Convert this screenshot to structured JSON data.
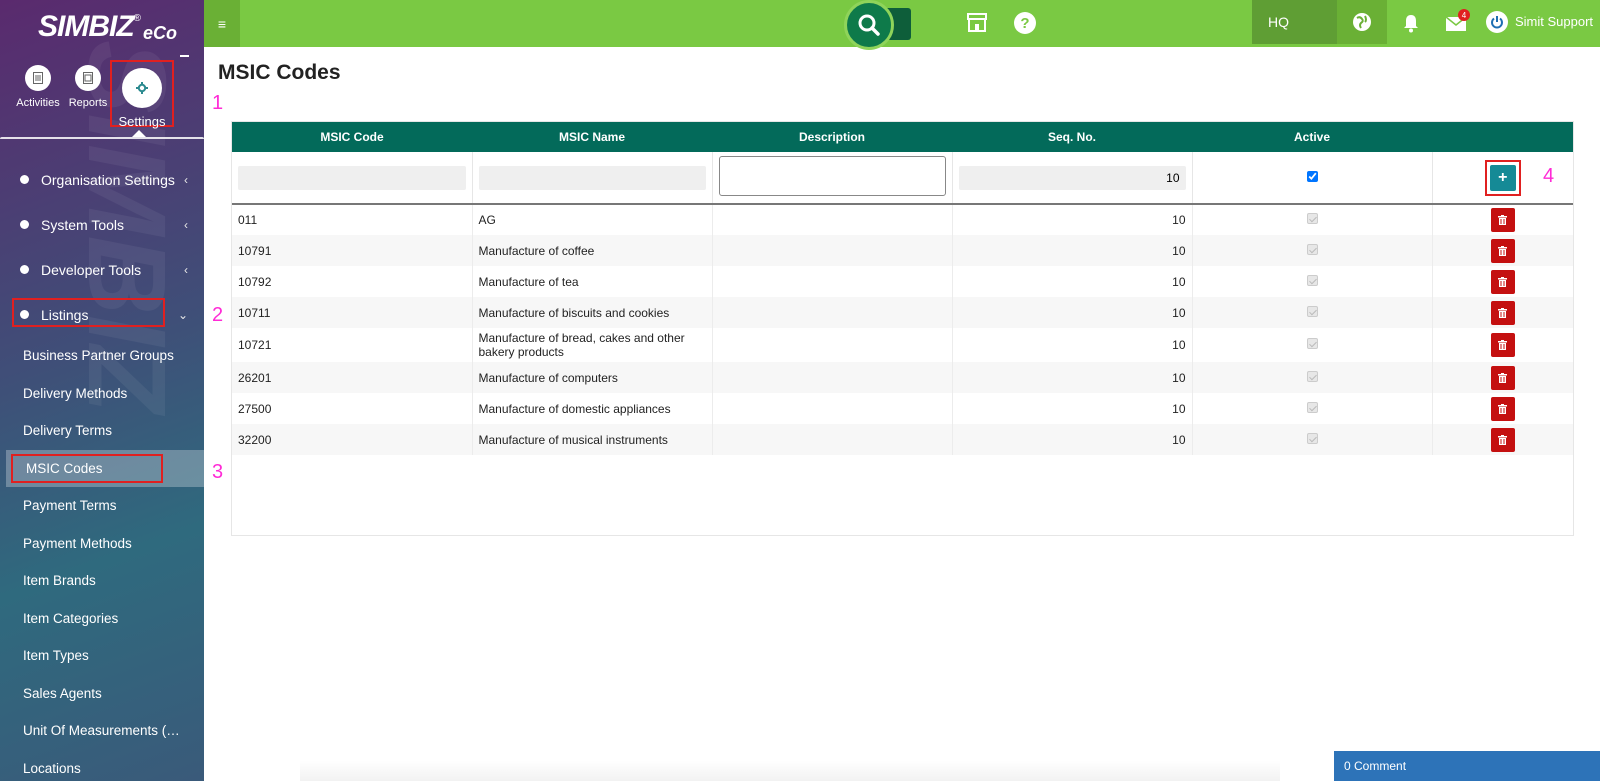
{
  "sidebar": {
    "logo_main": "SIMBIZ",
    "logo_reg": "®",
    "logo_eco": "eCo",
    "quick": [
      {
        "label": "Activities",
        "icon": "document-icon"
      },
      {
        "label": "Reports",
        "icon": "report-icon"
      },
      {
        "label": "Settings",
        "icon": "gear-icon"
      }
    ],
    "menu": [
      {
        "label": "Organisation Settings",
        "chevron": "‹"
      },
      {
        "label": "System Tools",
        "chevron": "‹"
      },
      {
        "label": "Developer Tools",
        "chevron": "‹"
      },
      {
        "label": "Listings",
        "chevron": "⌄"
      }
    ],
    "submenu": [
      "Business Partner Groups",
      "Delivery Methods",
      "Delivery Terms",
      "MSIC Codes",
      "Payment Terms",
      "Payment Methods",
      "Item Brands",
      "Item Categories",
      "Item Types",
      "Sales Agents",
      "Unit Of Measurements (…",
      "Locations"
    ]
  },
  "topbar": {
    "hamburger": "≡",
    "branch": "HQ",
    "mail_count": "4",
    "help": "?",
    "user_name": "Simit Support"
  },
  "page": {
    "title": "MSIC Codes",
    "annotations": [
      "1",
      "2",
      "3",
      "4"
    ]
  },
  "table": {
    "headers": [
      "MSIC Code",
      "MSIC Name",
      "Description",
      "Seq. No.",
      "Active",
      ""
    ],
    "new_row": {
      "code": "",
      "name": "",
      "description": "",
      "seq": "10",
      "active": true
    },
    "add_label": "+",
    "rows": [
      {
        "code": "011",
        "name": "AG",
        "description": "",
        "seq": "10"
      },
      {
        "code": "10791",
        "name": "Manufacture of coffee",
        "description": "",
        "seq": "10"
      },
      {
        "code": "10792",
        "name": "Manufacture of tea",
        "description": "",
        "seq": "10"
      },
      {
        "code": "10711",
        "name": "Manufacture of biscuits and cookies",
        "description": "",
        "seq": "10"
      },
      {
        "code": "10721",
        "name": "Manufacture of bread, cakes and other bakery products",
        "description": "",
        "seq": "10"
      },
      {
        "code": "26201",
        "name": "Manufacture of computers",
        "description": "",
        "seq": "10"
      },
      {
        "code": "27500",
        "name": "Manufacture of domestic appliances",
        "description": "",
        "seq": "10"
      },
      {
        "code": "32200",
        "name": "Manufacture of musical instruments",
        "description": "",
        "seq": "10"
      }
    ]
  },
  "footer": {
    "comment_label": "0 Comment"
  },
  "colors": {
    "topbar": "#7ac943",
    "table_header": "#036a5a",
    "delete": "#c41010",
    "add": "#158a96",
    "highlight": "#e02020",
    "annotation": "#ff2bd6"
  }
}
